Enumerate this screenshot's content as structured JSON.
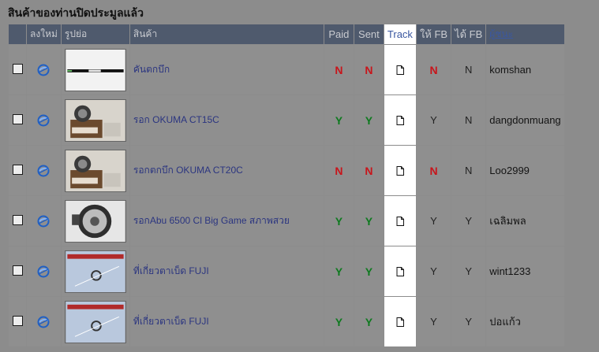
{
  "page": {
    "title": "สินค้าของท่านปิดประมูลแล้ว"
  },
  "table": {
    "headers": {
      "select": "",
      "repost": "ลงใหม่",
      "image": "รูปย่อ",
      "product": "สินค้า",
      "paid": "Paid",
      "sent": "Sent",
      "track": "Track",
      "give_fb": "ให้ FB",
      "got_fb": "ได้ FB",
      "winner": "ผู้ชนะ"
    },
    "rows": [
      {
        "product": "คันตกบึก",
        "paid": "N",
        "sent": "N",
        "give_fb": "N",
        "got_fb": "N",
        "winner": "komshan",
        "image_icon": "fishing-rod-photo"
      },
      {
        "product": "รอก OKUMA CT15C",
        "paid": "Y",
        "sent": "Y",
        "give_fb": "Y",
        "got_fb": "N",
        "winner": "dangdonmuang",
        "image_icon": "reel-box-photo"
      },
      {
        "product": "รอกตกบึก OKUMA CT20C",
        "paid": "N",
        "sent": "N",
        "give_fb": "N",
        "got_fb": "N",
        "winner": "Loo2999",
        "image_icon": "reel-box-photo"
      },
      {
        "product": "รอกAbu 6500 Cl Big Game สภาพสวย",
        "paid": "Y",
        "sent": "Y",
        "give_fb": "Y",
        "got_fb": "Y",
        "winner": "เฉลิมพล",
        "image_icon": "reel-photo"
      },
      {
        "product": "ที่เกี่ยวตาเบ็ด FUJI",
        "paid": "Y",
        "sent": "Y",
        "give_fb": "Y",
        "got_fb": "Y",
        "winner": "wint1233",
        "image_icon": "hook-keeper-photo"
      },
      {
        "product": "ที่เกี่ยวตาเบ็ด FUJI",
        "paid": "Y",
        "sent": "Y",
        "give_fb": "Y",
        "got_fb": "Y",
        "winner": "ปอแก้ว",
        "image_icon": "hook-keeper-photo"
      }
    ]
  },
  "colors": {
    "header_bg": "#4f5a6d",
    "no_flag": "#c8151b",
    "yes_flag": "#0e7a1f",
    "link": "#2b3580",
    "track_highlight": "#ffffff"
  }
}
